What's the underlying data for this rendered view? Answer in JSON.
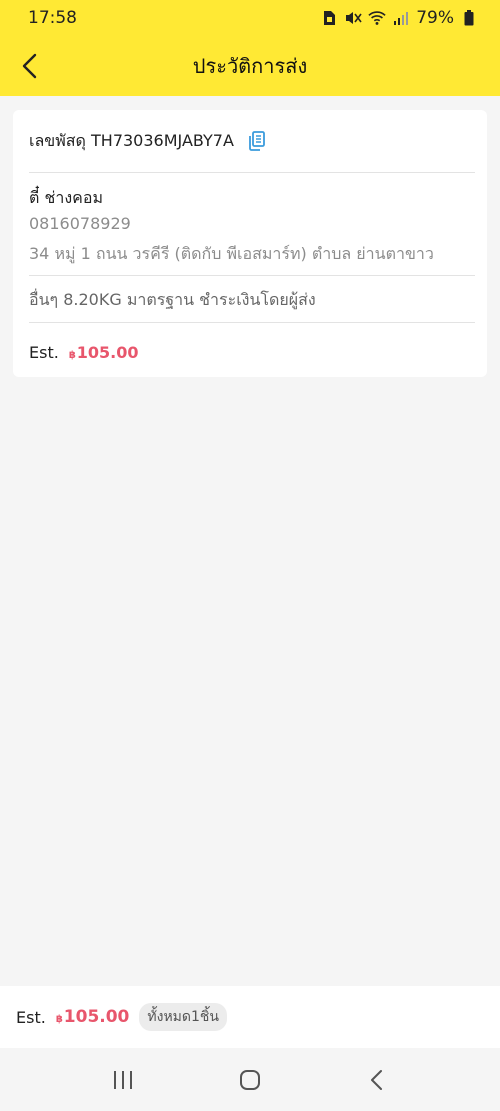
{
  "status_bar": {
    "time": "17:58",
    "battery": "79%",
    "icons": [
      "sim-icon",
      "mute-icon",
      "wifi-icon",
      "signal-icon",
      "battery-icon"
    ]
  },
  "header": {
    "title": "ประวัติการส่ง",
    "back_icon": "chevron-left-icon"
  },
  "shipment": {
    "tracking_label": "เลขพัสดุ",
    "tracking_number": "TH73036MJABY7A",
    "recipient_name": "ตี๋ ช่างคอม",
    "phone": "0816078929",
    "address": "34 หมู่ 1 ถนน วรคีรี (ติดกับ พีเอสมาร์ท) ตำบล ย่านตาขาว",
    "details": "อื่นๆ 8.20KG  มาตรฐาน ชำระเงินโดยผู้ส่ง",
    "est_label": "Est.",
    "currency": "฿",
    "price": "105.00"
  },
  "footer": {
    "est_label": "Est.",
    "currency": "฿",
    "price": "105.00",
    "count_text": "ทั้งหมด1ชิ้น"
  },
  "colors": {
    "header_bg": "#ffe934",
    "price": "#e8566c",
    "copy_icon": "#3a9bdc"
  }
}
